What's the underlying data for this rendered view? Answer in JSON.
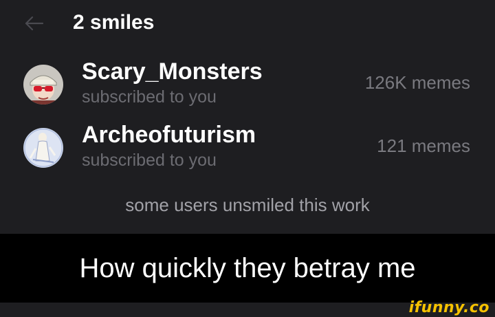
{
  "header": {
    "title": "2 smiles",
    "back_icon": "arrow-left-icon"
  },
  "users": [
    {
      "name": "Scary_Monsters",
      "subtitle": "subscribed to you",
      "memes": "126K memes",
      "avatar_icon": "avatar-cap-glasses"
    },
    {
      "name": "Archeofuturism",
      "subtitle": "subscribed to you",
      "memes": "121 memes",
      "avatar_icon": "avatar-figure-blue"
    }
  ],
  "note": "some users unsmiled this work",
  "caption": "How quickly they betray me",
  "watermark": "ifunny.co",
  "colors": {
    "background": "#1e1e21",
    "caption_bar": "#000000",
    "muted_text": "#6c6c72",
    "watermark": "#f6c200"
  }
}
